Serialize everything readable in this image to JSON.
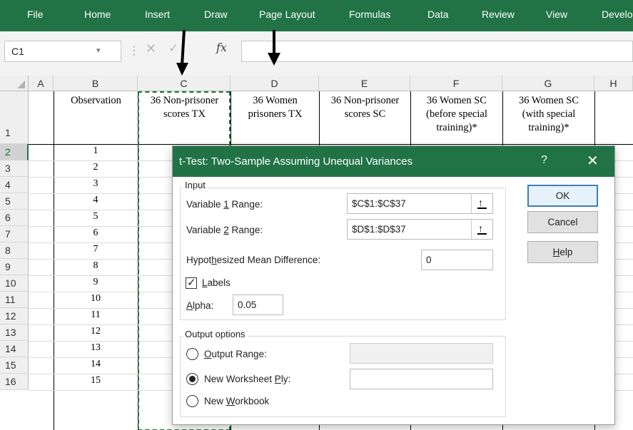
{
  "ribbon": {
    "tabs": [
      {
        "label": "File"
      },
      {
        "label": "Home"
      },
      {
        "label": "Insert"
      },
      {
        "label": "Draw"
      },
      {
        "label": "Page Layout"
      },
      {
        "label": "Formulas"
      },
      {
        "label": "Data"
      },
      {
        "label": "Review"
      },
      {
        "label": "View"
      },
      {
        "label": "Develo"
      }
    ],
    "accent_color": "#217346"
  },
  "formula_bar": {
    "name_box": "C1",
    "fx_label": "fx",
    "value": ""
  },
  "grid": {
    "columns": [
      "A",
      "B",
      "C",
      "D",
      "E",
      "F",
      "G",
      "H"
    ],
    "rows": [
      "1",
      "2",
      "3",
      "4",
      "5",
      "6",
      "7",
      "8",
      "9",
      "10",
      "11",
      "12",
      "13",
      "14",
      "15",
      "16"
    ],
    "selected_row": "2",
    "headers": {
      "B": "Observation",
      "C": "36 Non-prisoner\nscores TX",
      "D": "36 Women\nprisoners TX",
      "E": "36 Non-prisoner\nscores SC",
      "F": "36 Women SC\n(before special\ntraining)*",
      "G": " 36  Women SC\n(with special\ntraining)*"
    },
    "observations": [
      "1",
      "2",
      "3",
      "4",
      "5",
      "6",
      "7",
      "8",
      "9",
      "10",
      "11",
      "12",
      "13",
      "14",
      "15"
    ]
  },
  "dialog": {
    "title": "t-Test: Two-Sample Assuming Unequal Variances",
    "help_glyph": "?",
    "close_glyph": "✕",
    "input_group": "Input",
    "var1": {
      "pre": "Variable ",
      "key": "1",
      "post": " Range:",
      "value": "$C$1:$C$37"
    },
    "var2": {
      "pre": "Variable ",
      "key": "2",
      "post": " Range:",
      "value": "$D$1:$D$37"
    },
    "hypo": {
      "pre": "Hypot",
      "key": "h",
      "post": "esized Mean Difference:",
      "value": "0"
    },
    "labels": {
      "key": "L",
      "post": "abels",
      "checked": true
    },
    "alpha": {
      "key": "A",
      "post": "lpha:",
      "value": "0.05"
    },
    "output_group": "Output options",
    "output_range": {
      "key": "O",
      "post": "utput Range:",
      "value": "",
      "selected": false
    },
    "new_ply": {
      "pre": "New Worksheet ",
      "key": "P",
      "post": "ly:",
      "value": "",
      "selected": true
    },
    "new_workbook": {
      "pre": "New ",
      "key": "W",
      "post": "orkbook",
      "selected": false
    },
    "buttons": {
      "ok": "OK",
      "cancel": "Cancel",
      "help": {
        "key": "H",
        "post": "elp"
      }
    }
  }
}
